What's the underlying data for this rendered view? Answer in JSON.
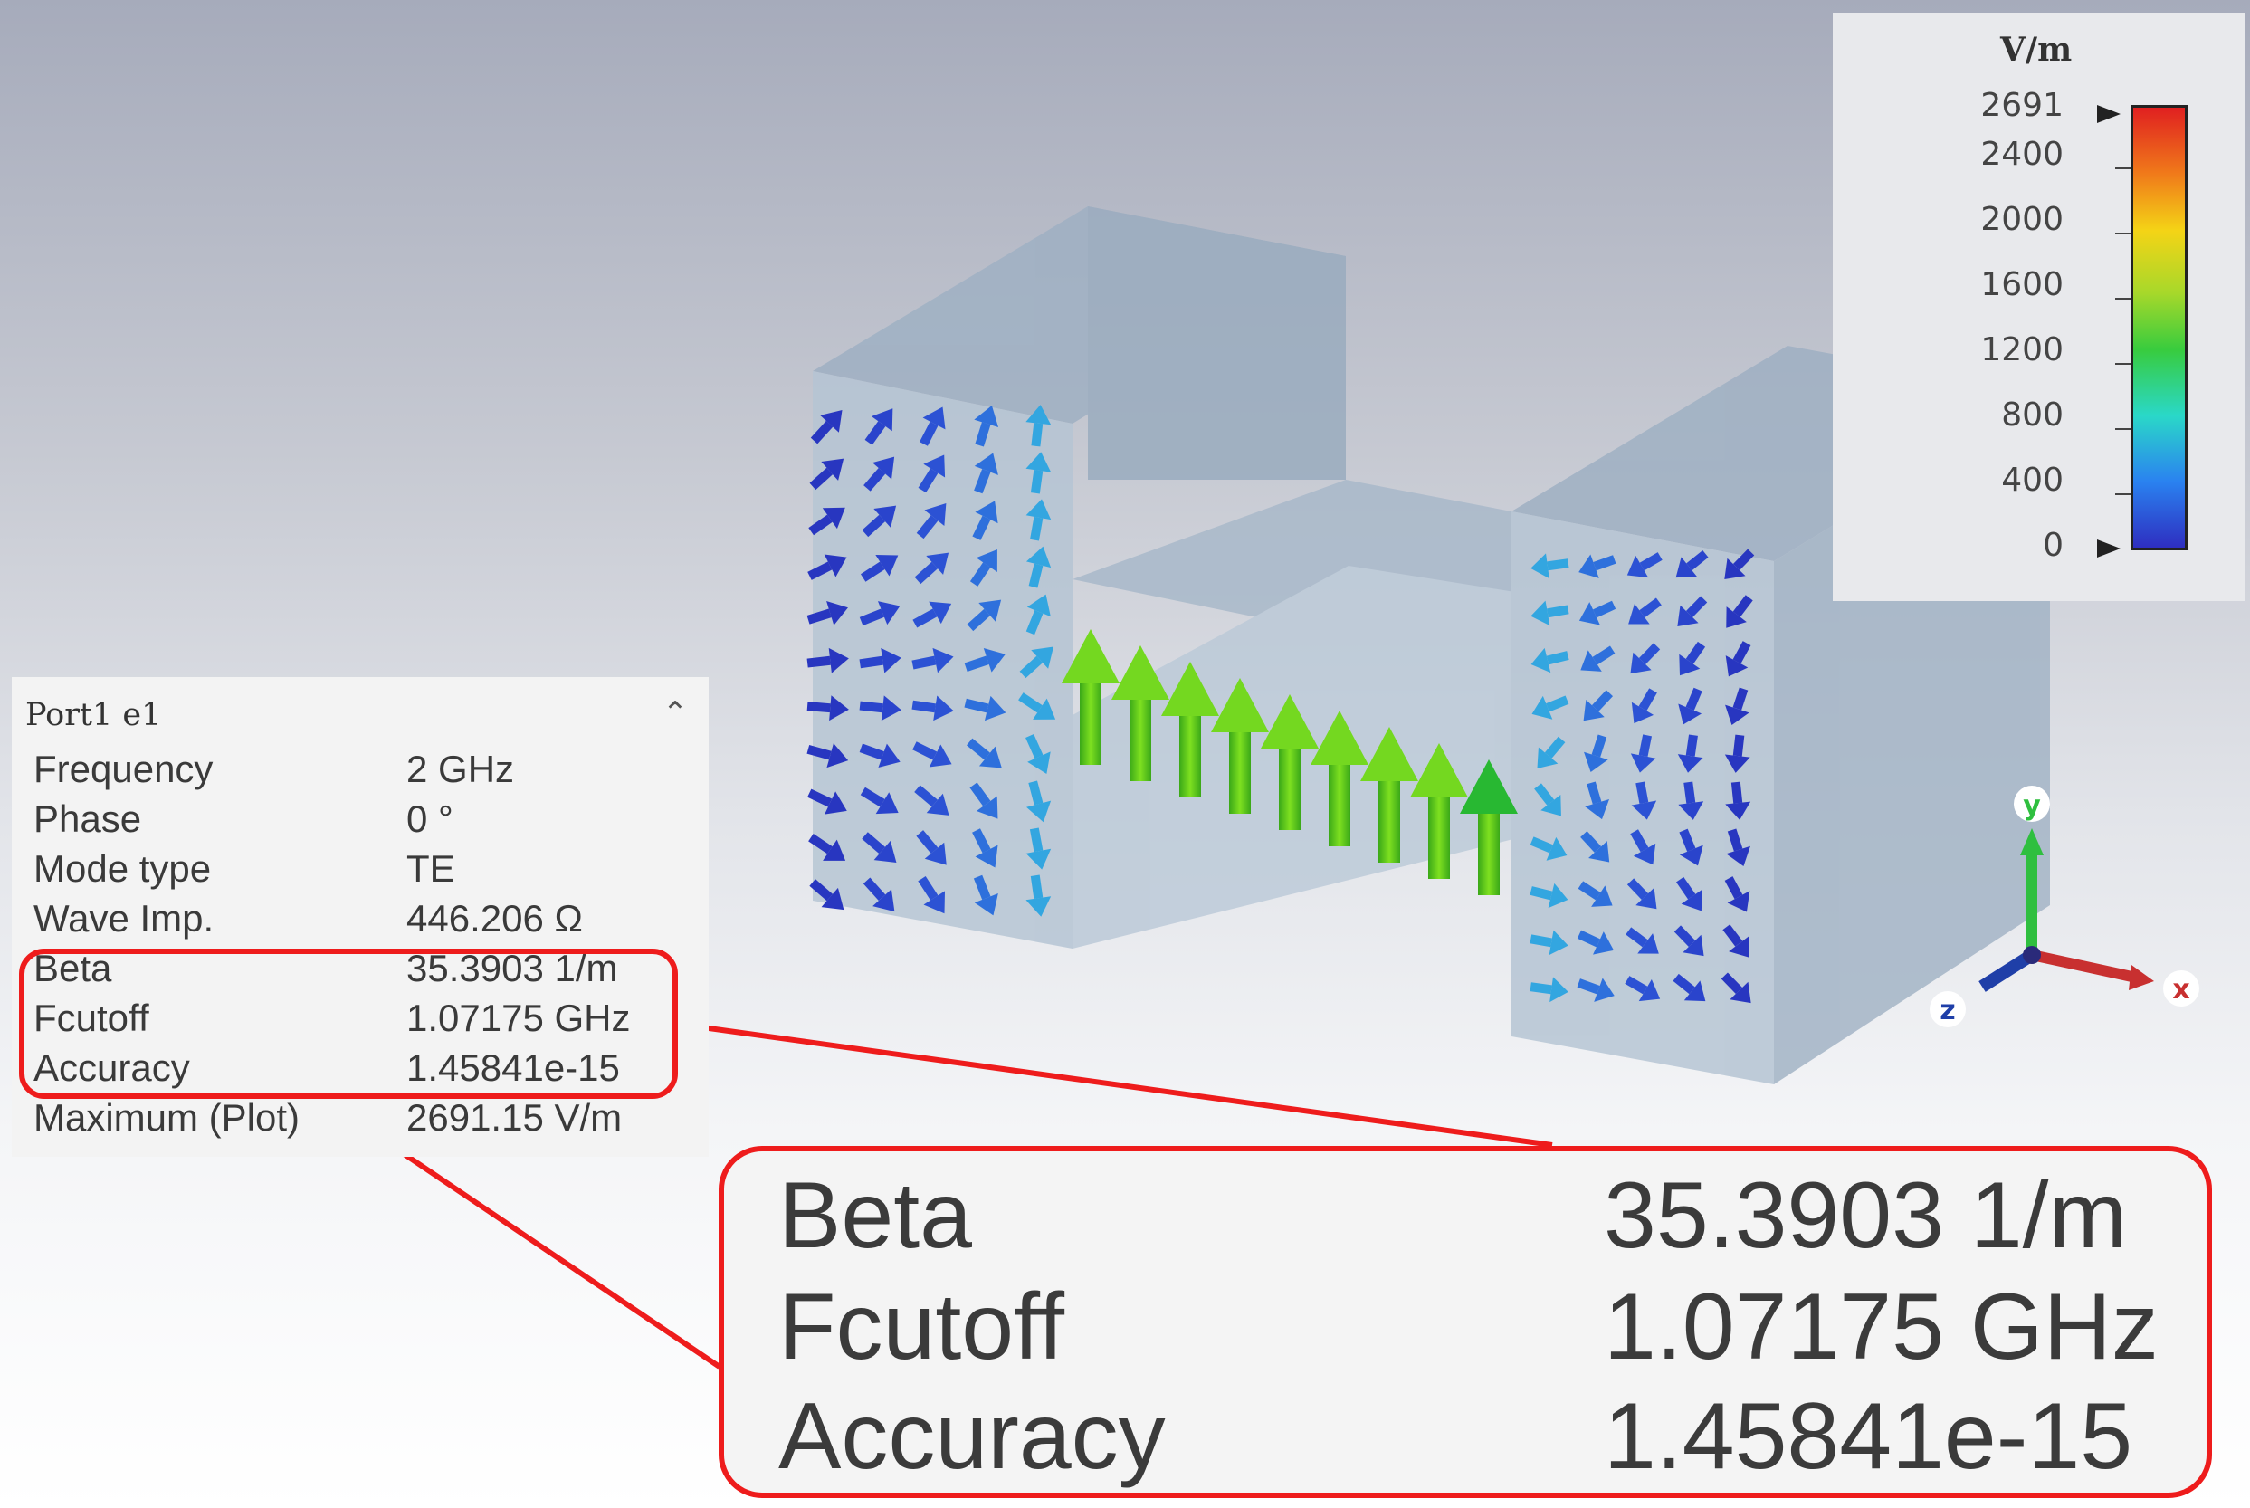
{
  "legend": {
    "unit": "V/m",
    "ticks": [
      "2691",
      "2400",
      "2000",
      "1600",
      "1200",
      "800",
      "400",
      "0"
    ]
  },
  "axes": {
    "x": "x",
    "y": "y",
    "z": "z"
  },
  "port_panel": {
    "title": "Port1 e1",
    "collapse_icon": "chevron-up-icon",
    "rows": [
      {
        "key": "Frequency",
        "value": "2 GHz"
      },
      {
        "key": "Phase",
        "value": "0 °"
      },
      {
        "key": "Mode type",
        "value": "TE"
      },
      {
        "key": "Wave Imp.",
        "value": "446.206 Ω"
      },
      {
        "key": "Beta",
        "value": "35.3903 1/m"
      },
      {
        "key": "Fcutoff",
        "value": "1.07175 GHz"
      },
      {
        "key": "Accuracy",
        "value": "1.45841e-15"
      },
      {
        "key": "Maximum (Plot)",
        "value": "2691.15 V/m"
      }
    ]
  },
  "zoom_callout": {
    "rows": [
      {
        "key": "Beta",
        "value": "35.3903 1/m"
      },
      {
        "key": "Fcutoff",
        "value": "1.07175 GHz"
      },
      {
        "key": "Accuracy",
        "value": "1.45841e-15"
      }
    ]
  },
  "colors": {
    "highlight": "#ee1c1c",
    "field_low": "#2a3ec8",
    "field_mid": "#38cc3e",
    "field_high": "#e02020"
  }
}
